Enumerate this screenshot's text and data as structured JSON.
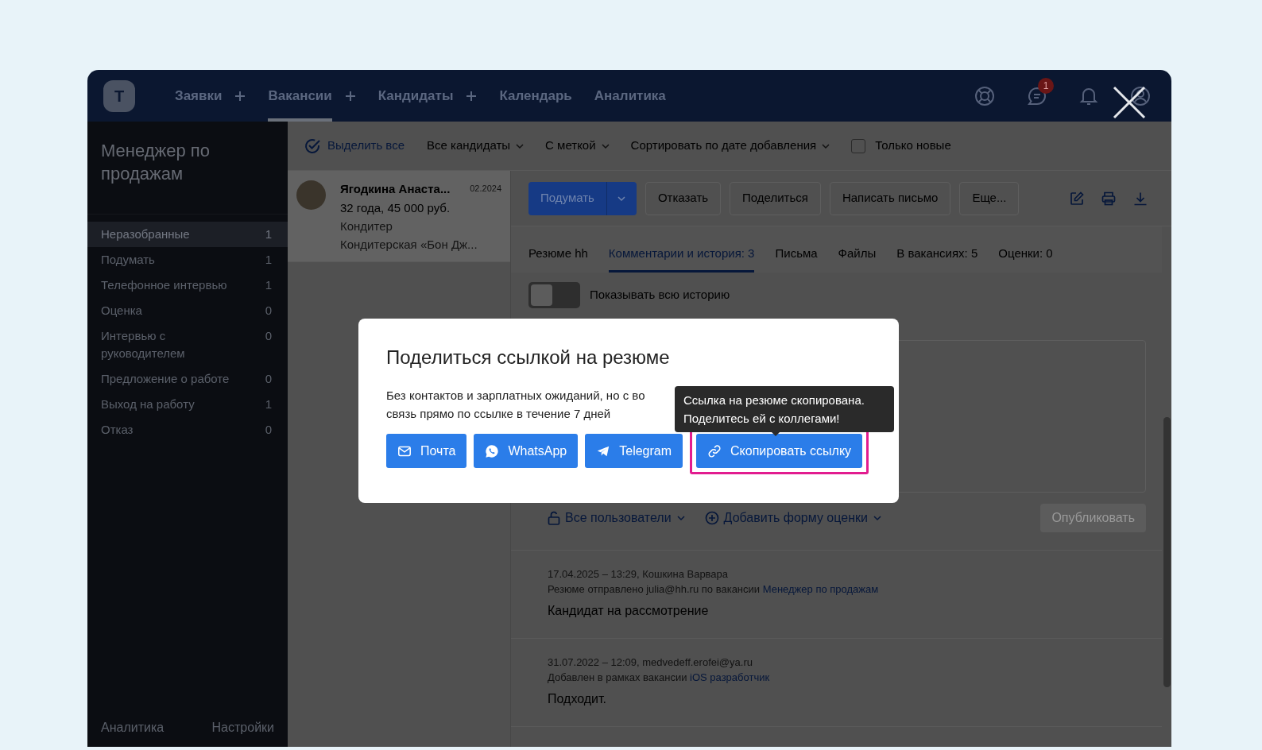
{
  "nav": {
    "logo_letter": "T",
    "items": [
      {
        "label": "Заявки",
        "selected": false,
        "has_add": true
      },
      {
        "label": "Вакансии",
        "selected": true,
        "has_add": true
      },
      {
        "label": "Кандидаты",
        "selected": false,
        "has_add": true
      },
      {
        "label": "Календарь",
        "selected": false,
        "has_add": false
      },
      {
        "label": "Аналитика",
        "selected": false,
        "has_add": false
      }
    ],
    "messages_badge": "1"
  },
  "sidebar": {
    "title": "Менеджер по продажам",
    "stages": [
      {
        "label": "Неразобранные",
        "count": "1",
        "selected": true
      },
      {
        "label": "Подумать",
        "count": "1",
        "selected": false
      },
      {
        "label": "Телефонное интервью",
        "count": "1",
        "selected": false
      },
      {
        "label": "Оценка",
        "count": "0",
        "selected": false
      },
      {
        "label": "Интервью с руководителем",
        "count": "0",
        "selected": false
      },
      {
        "label": "Предложение о работе",
        "count": "0",
        "selected": false
      },
      {
        "label": "Выход на работу",
        "count": "1",
        "selected": false
      },
      {
        "label": "Отказ",
        "count": "0",
        "selected": false
      }
    ],
    "footer_links": [
      "Аналитика",
      "Настройки"
    ]
  },
  "filter_bar": {
    "select_all": "Выделить все",
    "dropdowns": [
      "Все кандидаты",
      "С меткой",
      "Сортировать по дате добавления"
    ],
    "only_new": {
      "label": "Только новые",
      "checked": false
    }
  },
  "candidates": [
    {
      "name": "Ягодкина Анаста...",
      "date": "02.2024",
      "summary": "32 года, 45 000 руб.",
      "position": "Кондитер",
      "company": "Кондитерская «Бон Дж...",
      "selected": true
    }
  ],
  "actions": {
    "primary": "Подумать",
    "buttons": [
      "Отказать",
      "Поделиться",
      "Написать письмо",
      "Еще..."
    ]
  },
  "tabs": [
    {
      "label": "Резюме hh",
      "selected": false
    },
    {
      "label": "Комментарии и история: 3",
      "selected": true
    },
    {
      "label": "Письма",
      "selected": false
    },
    {
      "label": "Файлы",
      "selected": false
    },
    {
      "label": "В вакансиях: 5",
      "selected": false
    },
    {
      "label": "Оценки: 0",
      "selected": false
    }
  ],
  "history_toggle": {
    "label": "Показывать всю историю",
    "on": false
  },
  "comment_bar": {
    "visibility": "Все пользователи",
    "add_form": "Добавить форму оценки",
    "publish": {
      "label": "Опубликовать",
      "disabled": true
    }
  },
  "history": [
    {
      "meta": "17.04.2025 – 13:29, Кошкина Варвара",
      "note": "Резюме отправлено julia@hh.ru по вакансии",
      "link": "Менеджер по продажам",
      "text": "Кандидат на рассмотрение"
    },
    {
      "meta": "31.07.2022 – 12:09, medvedeff.erofei@ya.ru",
      "note": "Добавлен в рамках вакансии",
      "link": "iOS разработчик",
      "text": "Подходит."
    }
  ],
  "modal": {
    "title": "Поделиться ссылкой на резюме",
    "description_lines": [
      "Без контактов и зарплатных ожиданий, но с во",
      "связь прямо по ссылке в течение 7 дней"
    ],
    "share_buttons": [
      {
        "kind": "mail",
        "label": "Почта",
        "highlighted": false
      },
      {
        "kind": "whatsapp",
        "label": "WhatsApp",
        "highlighted": false
      },
      {
        "kind": "telegram",
        "label": "Telegram",
        "highlighted": false
      },
      {
        "kind": "link",
        "label": "Скопировать ссылку",
        "highlighted": true
      }
    ],
    "tooltip_lines": [
      "Ссылка на резюме скопирована.",
      "Поделитесь ей с коллегами!"
    ]
  }
}
